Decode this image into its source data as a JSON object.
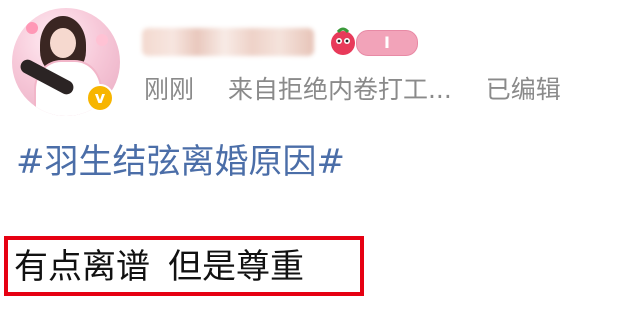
{
  "post": {
    "meta": {
      "time": "刚刚",
      "source": "来自拒绝内卷打工...",
      "edited": "已编辑"
    },
    "hashtag": "#羽生结弦离婚原因#",
    "content": {
      "part1": "有点离谱",
      "part2": "但是尊重"
    },
    "badge": {
      "label": "I"
    }
  },
  "colors": {
    "hashtag": "#4b6ea8",
    "meta": "#8a8a8a",
    "highlight_border": "#e60012",
    "badge": "#f2a3b9",
    "verified": "#f7b500"
  }
}
